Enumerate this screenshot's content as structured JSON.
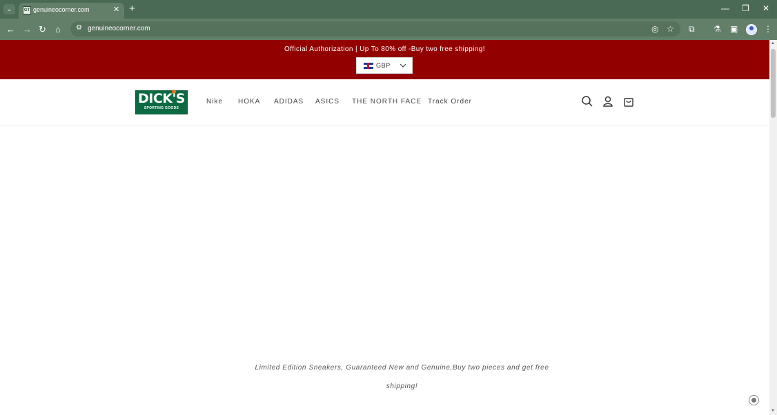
{
  "browser": {
    "tab_title": "genuineocorner.com",
    "tab_close": "✕",
    "new_tab": "+",
    "url": "genuineocorner.com",
    "win_minimize": "—",
    "win_restore": "❐",
    "win_close": "✕",
    "favicon": "GT"
  },
  "announcement": {
    "text": "Official Authorization | Up To 80% off -Buy two free shipping!",
    "currency": "GBP"
  },
  "logo": {
    "main": "DICK'S",
    "sub": "SPORTING GOODS"
  },
  "nav": {
    "items": [
      "Nike",
      "HOKA",
      "ADIDAS",
      "ASICS",
      "THE NORTH FACE",
      "Track Order"
    ]
  },
  "hero": {
    "tagline_line1": "Limited Edition Sneakers, Guaranteed New and Genuine,Buy two pieces and get free",
    "tagline_line2": "shipping!"
  },
  "colors": {
    "chrome": "#4b6a55",
    "announcement_bg": "#930000",
    "logo_green": "#0c6a43"
  }
}
